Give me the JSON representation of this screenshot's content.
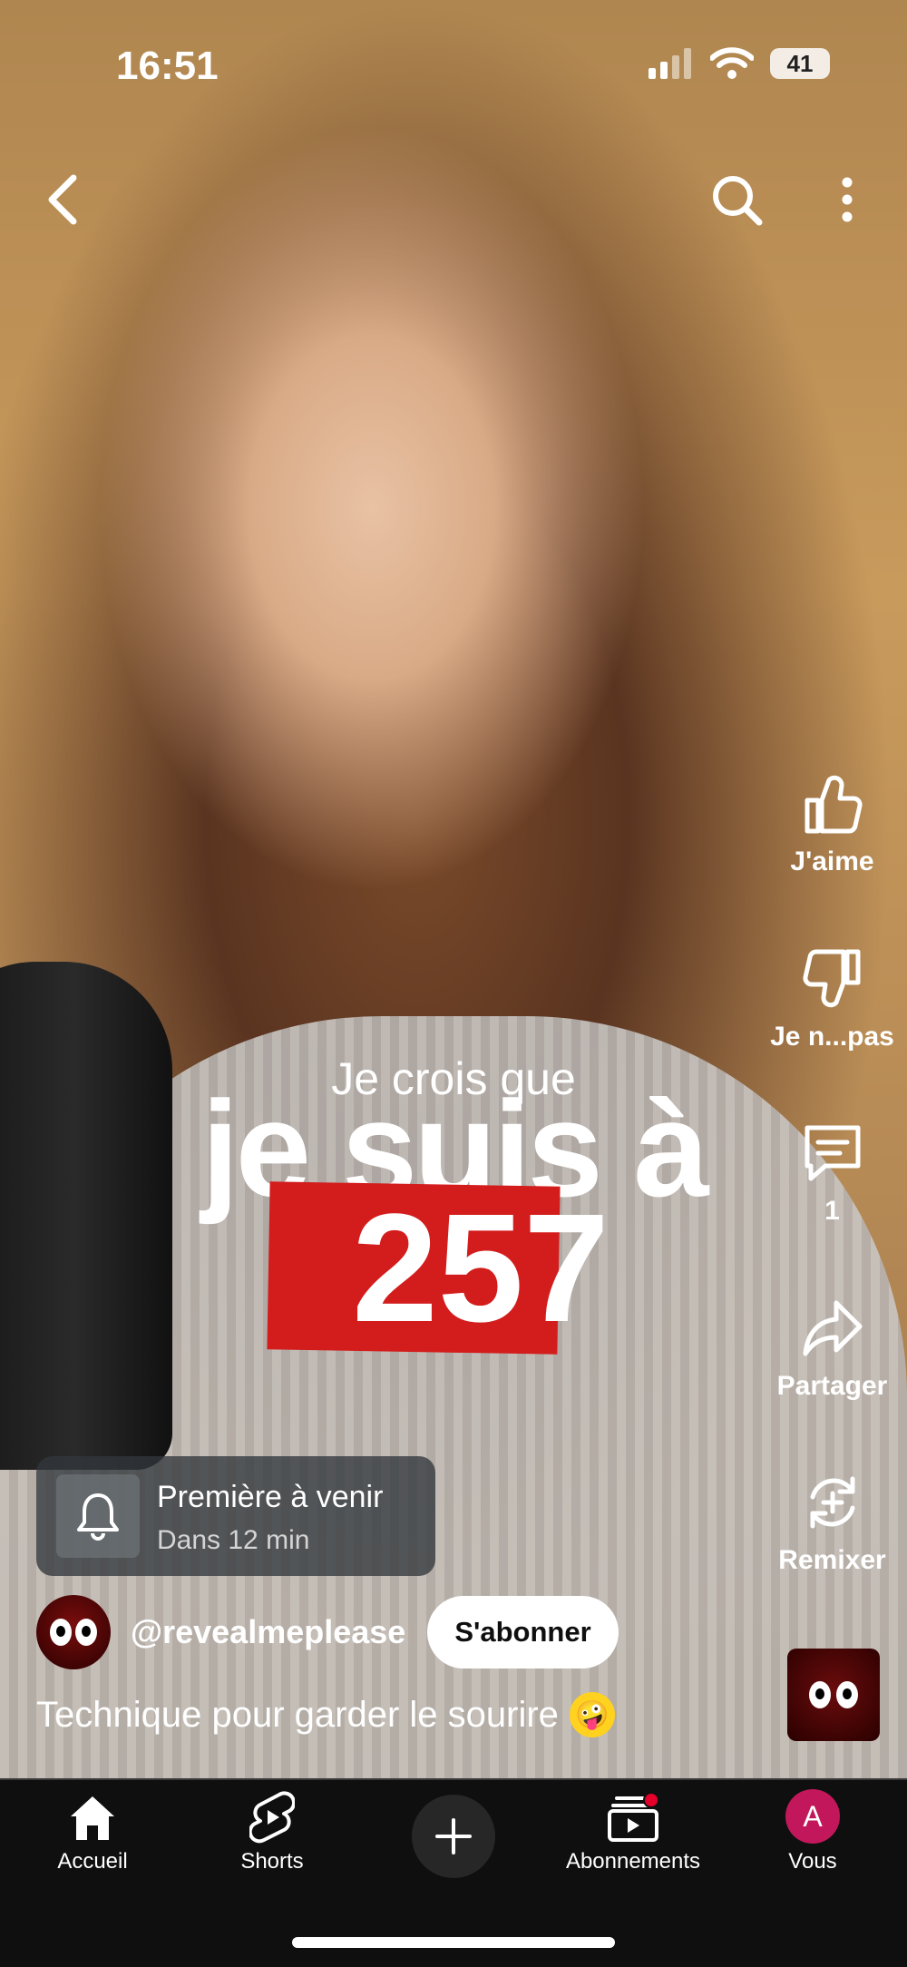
{
  "status": {
    "time": "16:51",
    "battery": "41"
  },
  "overlay": {
    "line1": "Je crois que",
    "line2": "je suis à",
    "number": "257"
  },
  "actions": {
    "like": "J'aime",
    "dislike": "Je n...pas",
    "comments": "1",
    "share": "Partager",
    "remix": "Remixer"
  },
  "premiere": {
    "title": "Première à venir",
    "subtitle": "Dans 12 min"
  },
  "channel": {
    "handle": "@revealmeplease",
    "subscribe_label": "S'abonner"
  },
  "caption": {
    "text": "Technique pour garder le sourire",
    "emoji": "🤪"
  },
  "nav": {
    "home": "Accueil",
    "shorts": "Shorts",
    "subscriptions": "Abonnements",
    "you": "Vous",
    "avatar_letter": "A"
  },
  "colors": {
    "accent_red": "#d31d1d",
    "nav_bg": "#0f0f0f",
    "avatar_pink": "#c2185b"
  }
}
